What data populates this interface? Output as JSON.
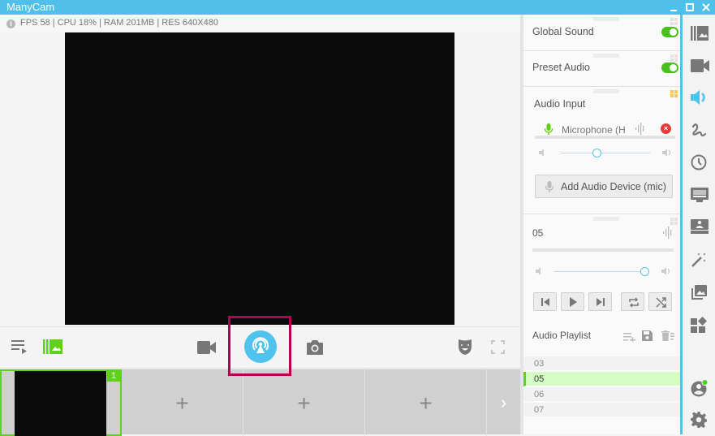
{
  "window": {
    "title": "ManyCam",
    "controls": {
      "minimize": "_",
      "maximize": "□",
      "close": "✕"
    }
  },
  "status": {
    "info_icon": "info-icon",
    "text": "FPS 58 | CPU 18% | RAM 201MB | RES 640X480"
  },
  "toolbar": {
    "left": [
      {
        "name": "playlist-icon"
      },
      {
        "name": "presets-icon",
        "active": true
      }
    ],
    "center": [
      {
        "name": "video-camera-icon"
      },
      {
        "name": "broadcast-icon",
        "active": true
      },
      {
        "name": "snapshot-camera-icon"
      }
    ],
    "right": [
      {
        "name": "face-mask-icon"
      },
      {
        "name": "fullscreen-icon"
      }
    ]
  },
  "sources": {
    "slots": [
      {
        "index": "1",
        "filled": true
      },
      {
        "plus": "+"
      },
      {
        "plus": "+"
      },
      {
        "plus": "+"
      }
    ],
    "next_arrow": "›"
  },
  "panel": {
    "global_sound": {
      "label": "Global Sound",
      "enabled": true
    },
    "preset_audio": {
      "label": "Preset Audio",
      "enabled": true
    },
    "audio_input": {
      "label": "Audio Input",
      "device": {
        "name": "Microphone (H",
        "volume_pct": 40
      },
      "add_button": "Add Audio Device (mic)"
    },
    "player": {
      "track": "05",
      "volume_pct": 95,
      "controls": [
        "previous",
        "play",
        "next",
        "repeat",
        "shuffle"
      ]
    },
    "playlist": {
      "label": "Audio Playlist",
      "actions": [
        "add-to-playlist",
        "save-playlist",
        "clear-playlist"
      ],
      "items": [
        {
          "name": "03",
          "active": false
        },
        {
          "name": "05",
          "active": true
        },
        {
          "name": "06",
          "active": false
        },
        {
          "name": "07",
          "active": false
        }
      ]
    }
  },
  "rail": {
    "items": [
      {
        "name": "presets",
        "active": false
      },
      {
        "name": "video-sources",
        "active": false
      },
      {
        "name": "audio",
        "active": true
      },
      {
        "name": "drawing",
        "active": false
      },
      {
        "name": "time-history",
        "active": false
      },
      {
        "name": "lower-thirds",
        "active": false
      },
      {
        "name": "chroma-key",
        "active": false
      },
      {
        "name": "effects",
        "active": false
      },
      {
        "name": "images",
        "active": false
      },
      {
        "name": "widgets",
        "active": false
      }
    ],
    "bottom": [
      {
        "name": "account",
        "online": true
      },
      {
        "name": "settings"
      }
    ]
  },
  "colors": {
    "accent": "#4fc2ee",
    "active_green": "#5fd11b",
    "highlight": "#b8004f",
    "active_row": "#d5fcc5"
  }
}
